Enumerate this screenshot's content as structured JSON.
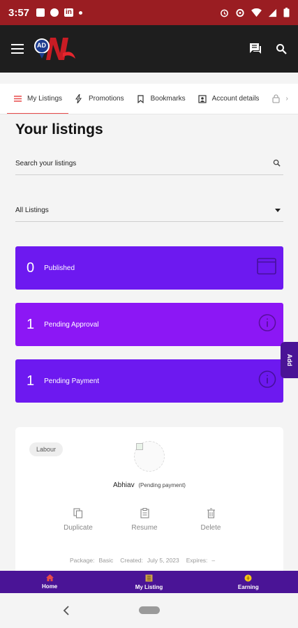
{
  "status_bar": {
    "time": "3:57"
  },
  "app_bar": {
    "menu_icon": "hamburger-icon",
    "logo_text": "AD",
    "right_icons": [
      "chat-icon",
      "search-icon"
    ]
  },
  "tabs": [
    {
      "label": "My Listings",
      "icon": "list-icon",
      "active": true
    },
    {
      "label": "Promotions",
      "icon": "bolt-icon",
      "active": false
    },
    {
      "label": "Bookmarks",
      "icon": "bookmark-icon",
      "active": false
    },
    {
      "label": "Account details",
      "icon": "account-icon",
      "active": false
    }
  ],
  "page": {
    "title": "Your listings"
  },
  "search": {
    "placeholder": "Search your listings"
  },
  "filter": {
    "selected": "All Listings"
  },
  "stats": [
    {
      "count": "0",
      "label": "Published",
      "color": "#6d19f0"
    },
    {
      "count": "1",
      "label": "Pending Approval",
      "color": "#8c17f5"
    },
    {
      "count": "1",
      "label": "Pending Payment",
      "color": "#6d19f0"
    }
  ],
  "side_tab": {
    "label": "Add"
  },
  "listing": {
    "category": "Labour",
    "name": "Abhiav",
    "status": "(Pending payment)",
    "actions": {
      "duplicate": "Duplicate",
      "resume": "Resume",
      "delete": "Delete"
    },
    "meta": {
      "package_label": "Package:",
      "package": "Basic",
      "created_label": "Created:",
      "created": "July 5, 2023",
      "expires_label": "Expires:",
      "expires": "–"
    }
  },
  "bottom_nav": [
    {
      "label": "Home",
      "icon": "home-icon"
    },
    {
      "label": "My Listing",
      "icon": "listing-icon"
    },
    {
      "label": "Earning",
      "icon": "coin-icon"
    }
  ]
}
